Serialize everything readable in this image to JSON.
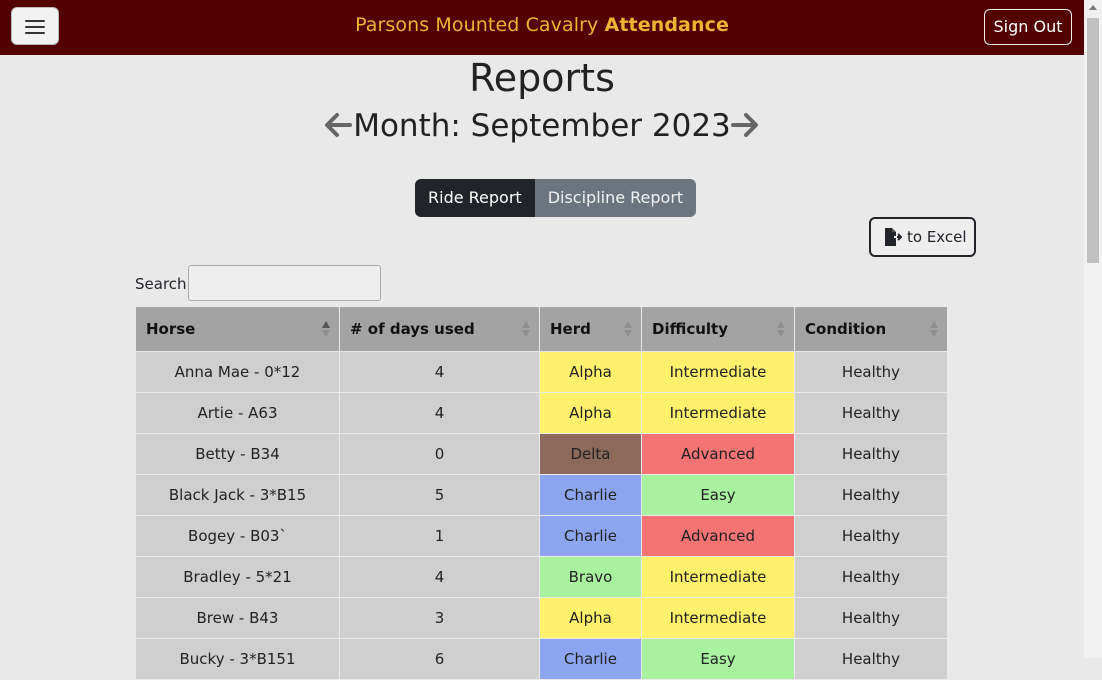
{
  "navbar": {
    "brand_prefix": "Parsons Mounted Cavalry ",
    "brand_bold": "Attendance",
    "sign_out": "Sign Out"
  },
  "page": {
    "title": "Reports",
    "month_label": "Month: September 2023"
  },
  "tabs": [
    {
      "label": "Ride Report",
      "active": true
    },
    {
      "label": "Discipline Report",
      "active": false
    }
  ],
  "export": {
    "label": "to Excel",
    "icon": "file-export-icon"
  },
  "search": {
    "label": "Search:",
    "value": ""
  },
  "table": {
    "columns": [
      "Horse",
      "# of days used",
      "Herd",
      "Difficulty",
      "Condition"
    ],
    "sorted_column": "Horse",
    "sort_direction": "ascending",
    "rows": [
      {
        "horse": "Anna Mae - 0*12",
        "days": "4",
        "herd": "Alpha",
        "difficulty": "Intermediate",
        "condition": "Healthy"
      },
      {
        "horse": "Artie - A63",
        "days": "4",
        "herd": "Alpha",
        "difficulty": "Intermediate",
        "condition": "Healthy"
      },
      {
        "horse": "Betty - B34",
        "days": "0",
        "herd": "Delta",
        "difficulty": "Advanced",
        "condition": "Healthy"
      },
      {
        "horse": "Black Jack - 3*B15",
        "days": "5",
        "herd": "Charlie",
        "difficulty": "Easy",
        "condition": "Healthy"
      },
      {
        "horse": "Bogey - B03`",
        "days": "1",
        "herd": "Charlie",
        "difficulty": "Advanced",
        "condition": "Healthy"
      },
      {
        "horse": "Bradley - 5*21",
        "days": "4",
        "herd": "Bravo",
        "difficulty": "Intermediate",
        "condition": "Healthy"
      },
      {
        "horse": "Brew - B43",
        "days": "3",
        "herd": "Alpha",
        "difficulty": "Intermediate",
        "condition": "Healthy"
      },
      {
        "horse": "Bucky - 3*B151",
        "days": "6",
        "herd": "Charlie",
        "difficulty": "Easy",
        "condition": "Healthy"
      }
    ]
  },
  "colors": {
    "navbar": "#530000",
    "brand": "#f0b232",
    "herd": {
      "Alpha": "#fff16c",
      "Bravo": "#a8f2a0",
      "Charlie": "#8ca5ee",
      "Delta": "#8c6a5b"
    },
    "difficulty": {
      "Intermediate": "#fff16c",
      "Advanced": "#f47373",
      "Easy": "#a8f2a0"
    }
  }
}
